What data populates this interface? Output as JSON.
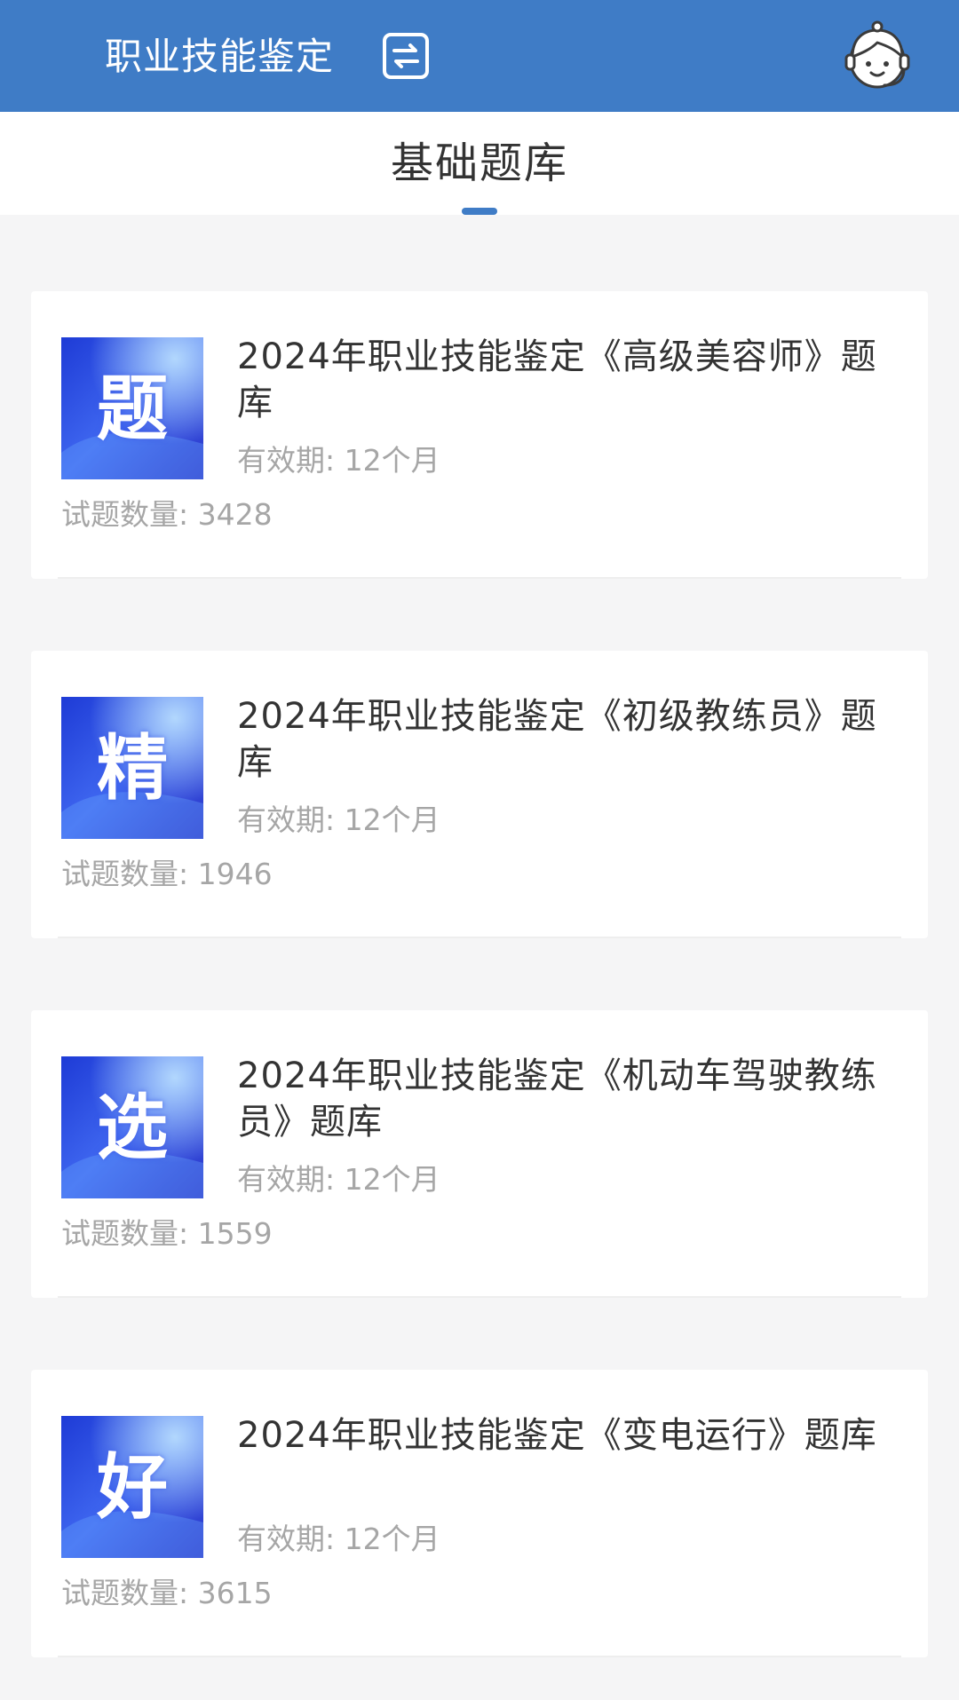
{
  "header": {
    "title": "职业技能鉴定",
    "switch_icon": "switch-icon",
    "service_icon": "customer-service-icon",
    "background_color": "#3f7cc6"
  },
  "tabs": [
    {
      "label": "基础题库",
      "active": true
    }
  ],
  "cards": [
    {
      "badge": "题",
      "title": "2024年职业技能鉴定《高级美容师》题库",
      "validity": "有效期: 12个月",
      "count": "试题数量: 3428"
    },
    {
      "badge": "精",
      "title": "2024年职业技能鉴定《初级教练员》题库",
      "validity": "有效期: 12个月",
      "count": "试题数量: 1946"
    },
    {
      "badge": "选",
      "title": "2024年职业技能鉴定《机动车驾驶教练员》题库",
      "validity": "有效期: 12个月",
      "count": "试题数量: 1559"
    },
    {
      "badge": "好",
      "title": "2024年职业技能鉴定《变电运行》题库",
      "validity": "有效期: 12个月",
      "count": "试题数量: 3615"
    }
  ]
}
